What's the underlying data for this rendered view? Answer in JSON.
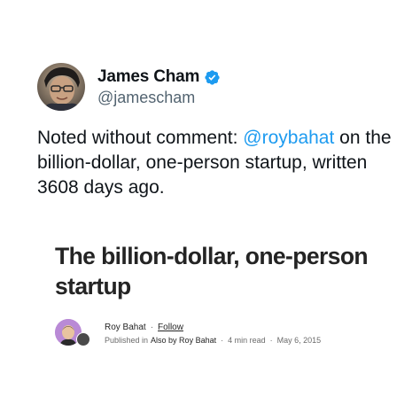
{
  "tweet": {
    "display_name": "James Cham",
    "handle": "@jamescham",
    "verified_icon": "verified-badge-icon",
    "text_prefix": "Noted without comment: ",
    "mention": "@roybahat",
    "text_suffix": " on the billion-dollar, one-person startup, written 3608 days ago."
  },
  "card": {
    "title": "The billion-dollar, one-person startup",
    "author": "Roy Bahat",
    "separator": "·",
    "follow_label": "Follow",
    "published_in_label": "Published in",
    "publication": "Also by Roy Bahat",
    "read_time": "4 min read",
    "date": "May 6, 2015"
  },
  "colors": {
    "mention": "#1d9bf0",
    "verified": "#1d9bf0",
    "text": "#0f1419",
    "secondary": "#536471"
  }
}
